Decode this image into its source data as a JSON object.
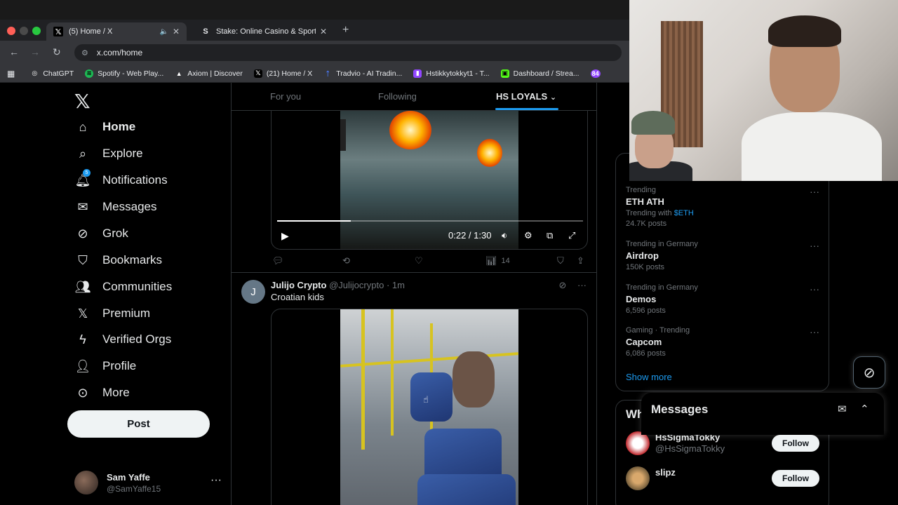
{
  "browser": {
    "tabs": [
      {
        "label": "(5) Home / X",
        "favicon": "x-logo-icon"
      },
      {
        "label": "Stake: Online Casino & Sports",
        "favicon": "stake-icon"
      }
    ],
    "url": "x.com/home",
    "bookmarks": [
      {
        "label": "ChatGPT"
      },
      {
        "label": "Spotify - Web Play..."
      },
      {
        "label": "Axiom | Discover"
      },
      {
        "label": "(21) Home / X"
      },
      {
        "label": "Tradvio - AI Tradin..."
      },
      {
        "label": "Hstikkytokkyt1 - T..."
      },
      {
        "label": "Dashboard / Strea..."
      },
      {
        "label": "84"
      }
    ]
  },
  "nav": {
    "items": [
      {
        "label": "Home",
        "icon": "home-icon"
      },
      {
        "label": "Explore",
        "icon": "search-icon"
      },
      {
        "label": "Notifications",
        "icon": "bell-icon",
        "badge": "5"
      },
      {
        "label": "Messages",
        "icon": "mail-icon"
      },
      {
        "label": "Grok",
        "icon": "grok-icon"
      },
      {
        "label": "Bookmarks",
        "icon": "bookmark-icon"
      },
      {
        "label": "Communities",
        "icon": "people-icon"
      },
      {
        "label": "Premium",
        "icon": "x-logo-icon"
      },
      {
        "label": "Verified Orgs",
        "icon": "lightning-icon"
      },
      {
        "label": "Profile",
        "icon": "user-icon"
      },
      {
        "label": "More",
        "icon": "more-circle-icon"
      }
    ],
    "post_label": "Post",
    "account": {
      "name": "Sam Yaffe",
      "handle": "@SamYaffe15"
    }
  },
  "feed": {
    "tabs": [
      "For you",
      "Following",
      "HS LOYALS"
    ],
    "video1": {
      "time": "0:22 / 1:30",
      "progress": 0.24
    },
    "actions": {
      "views": "14"
    },
    "post2": {
      "avatar_letter": "J",
      "name": "Julijo Crypto",
      "handle": "@Julijocrypto",
      "time": "· 1m",
      "text": "Croatian kids"
    }
  },
  "trends": [
    {
      "category": "Trending",
      "name": "ETH ATH",
      "sub_prefix": "Trending with ",
      "cashtag": "$ETH",
      "posts": "24.7K posts"
    },
    {
      "category": "Trending in Germany",
      "name": "Airdrop",
      "posts": "150K posts"
    },
    {
      "category": "Trending in Germany",
      "name": "Demos",
      "posts": "6,596 posts"
    },
    {
      "category": "Gaming · Trending",
      "name": "Capcom",
      "posts": "6,086 posts"
    }
  ],
  "show_more": "Show more",
  "who_to_follow": {
    "title": "Who to follow",
    "users": [
      {
        "name": "HsSigmaTokky",
        "handle": "@HsSigmaTokky",
        "button": "Follow"
      },
      {
        "name": "slipz",
        "handle": "",
        "button": "Follow"
      }
    ]
  },
  "messages_drawer": {
    "title": "Messages"
  },
  "colors": {
    "accent": "#1d9bf0",
    "background": "#000000",
    "border": "#2f3336",
    "muted": "#71767b"
  }
}
